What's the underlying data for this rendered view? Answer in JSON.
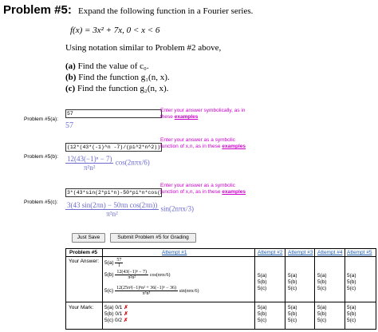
{
  "problem": {
    "title": "Problem #5:",
    "description": "Expand the following function in a Fourier series.",
    "function": "f(x) = 3x² + 7x,  0 < x < 6",
    "notation": "Using notation similar to Problem #2 above,",
    "parts": [
      {
        "label": "(a)",
        "text": "Find the value of c₀."
      },
      {
        "label": "(b)",
        "text": "Find the function g₁(n, x)."
      },
      {
        "label": "(c)",
        "text": "Find the function g₂(n, x)."
      }
    ]
  },
  "answers": [
    {
      "label": "Problem #5(a):",
      "value": "57",
      "help": "Enter your answer symbolically, as in these",
      "help_link": "examples",
      "preview": "57"
    },
    {
      "label": "Problem #5(b):",
      "value": "(12*(43*(-1)^n -7)/(pi^2*n^2))*(c",
      "help": "Enter your answer as a symbolic function of x,n, as in these",
      "help_link": "examples",
      "preview_num": "12(43(−1)ⁿ − 7)",
      "preview_den": "π²n²",
      "preview_tail": "cos(2nπx/6)"
    },
    {
      "label": "Problem #5(c):",
      "value": "3*(43*sin(2*pi*n)-50*pi*n*cos(2*p",
      "help": "Enter your answer as a symbolic function of x,n, as in these",
      "help_link": "examples",
      "preview_num": "3(43 sin(2πn) − 50πn cos(2πn))",
      "preview_den": "π²n²",
      "preview_tail": "sin(2nπx/3)"
    }
  ],
  "buttons": {
    "save": "Just Save",
    "submit": "Submit Problem #5 for Grading"
  },
  "results": {
    "title": "Problem #5",
    "attempts": [
      "Attempt #1",
      "Attempt #2",
      "Attempt #3",
      "Attempt #4",
      "Attempt #5"
    ],
    "your_answer_label": "Your Answer:",
    "your_mark_label": "Your Mark:",
    "a1_a_label": "5(a)",
    "a1_a_num": "57",
    "a1_a_den": "1",
    "a1_b_label": "5(b)",
    "a1_b_num": "12(43(−1)ⁿ − 7)",
    "a1_b_den": "π²n²",
    "a1_b_tail": "cos(nπx/6)",
    "a1_c_label": "5(c)",
    "a1_c_num": "12(25π²(−1)ⁿn² + 36(−1)ⁿ − 36)",
    "a1_c_den": "π³n³",
    "a1_c_tail": "sin(nπx/6)",
    "other_labels": [
      "5(a)",
      "5(b)",
      "5(c)"
    ],
    "marks": [
      {
        "part": "5(a)",
        "score": "0/1",
        "symbol": "✗"
      },
      {
        "part": "5(b)",
        "score": "0/1",
        "symbol": "✗"
      },
      {
        "part": "5(c)",
        "score": "0/2",
        "symbol": "✗"
      }
    ]
  },
  "colors": {
    "help": "#cc00cc",
    "preview": "#6a6ad0",
    "link": "#1a5bb0",
    "wrong": "#e00000"
  }
}
